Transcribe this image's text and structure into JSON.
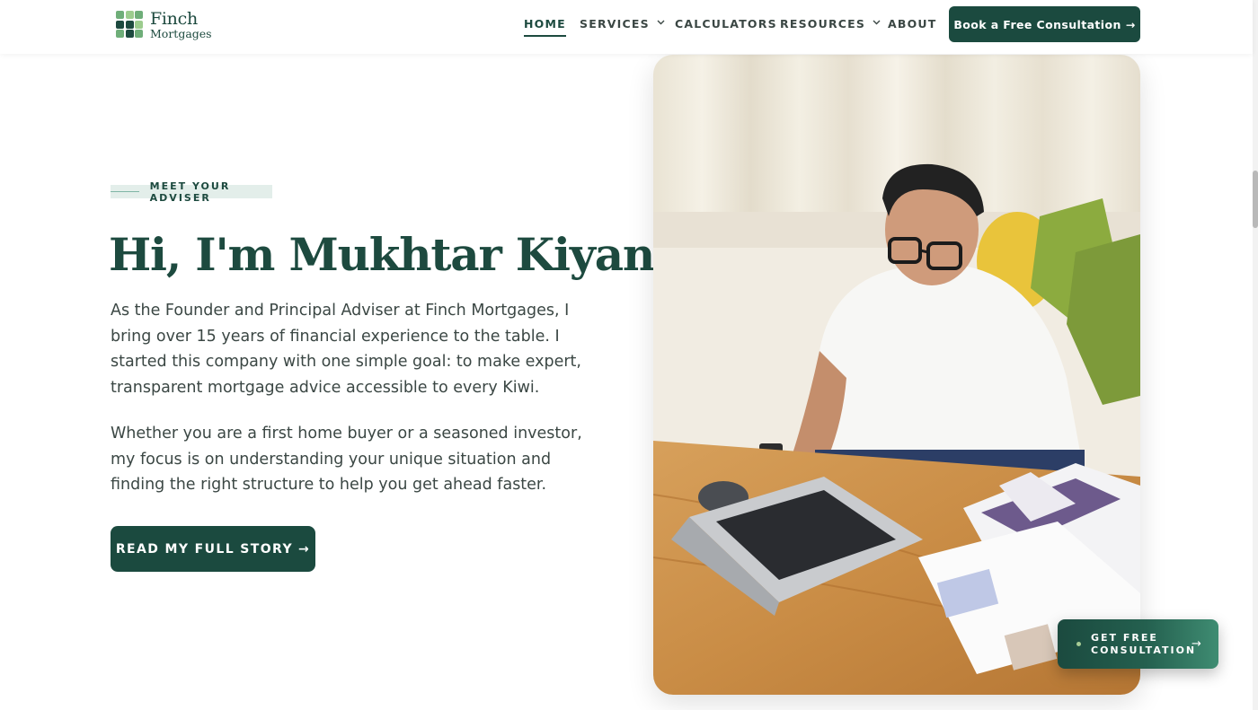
{
  "brand": {
    "name": "Finch",
    "sub": "Mortgages"
  },
  "nav": {
    "items": [
      {
        "label": "HOME",
        "active": true
      },
      {
        "label": "SERVICES",
        "dropdown": true
      },
      {
        "label": "CALCULATORS"
      },
      {
        "label": "RESOURCES",
        "dropdown": true
      },
      {
        "label": "ABOUT"
      }
    ],
    "cta_label": "Book a Free Consultation",
    "cta_arrow": "→"
  },
  "hero": {
    "eyebrow": "MEET YOUR ADVISER",
    "headline": "Hi, I'm Mukhtar Kiyani.",
    "paragraph1": "As the Founder and Principal Adviser at Finch Mortgages, I bring over 15 years of financial experience to the table. I started this company with one simple goal: to make expert, transparent mortgage advice accessible to every Kiwi.",
    "paragraph2": "Whether you are a first home buyer or a seasoned investor, my focus is on understanding your unique situation and finding the right structure to help you get ahead faster.",
    "button_label": "READ MY FULL STORY",
    "button_arrow": "→"
  },
  "floating_cta": {
    "label": "GET FREE CONSULTATION",
    "arrow": "→"
  },
  "icons": {
    "chevron": "chevron-down-icon",
    "arrow": "arrow-right-icon"
  },
  "colors": {
    "brand_dark": "#1b4a3f",
    "brand_light": "#9ccc8e",
    "text": "#3b4744",
    "eyebrow_bg": "#e3eeea"
  }
}
